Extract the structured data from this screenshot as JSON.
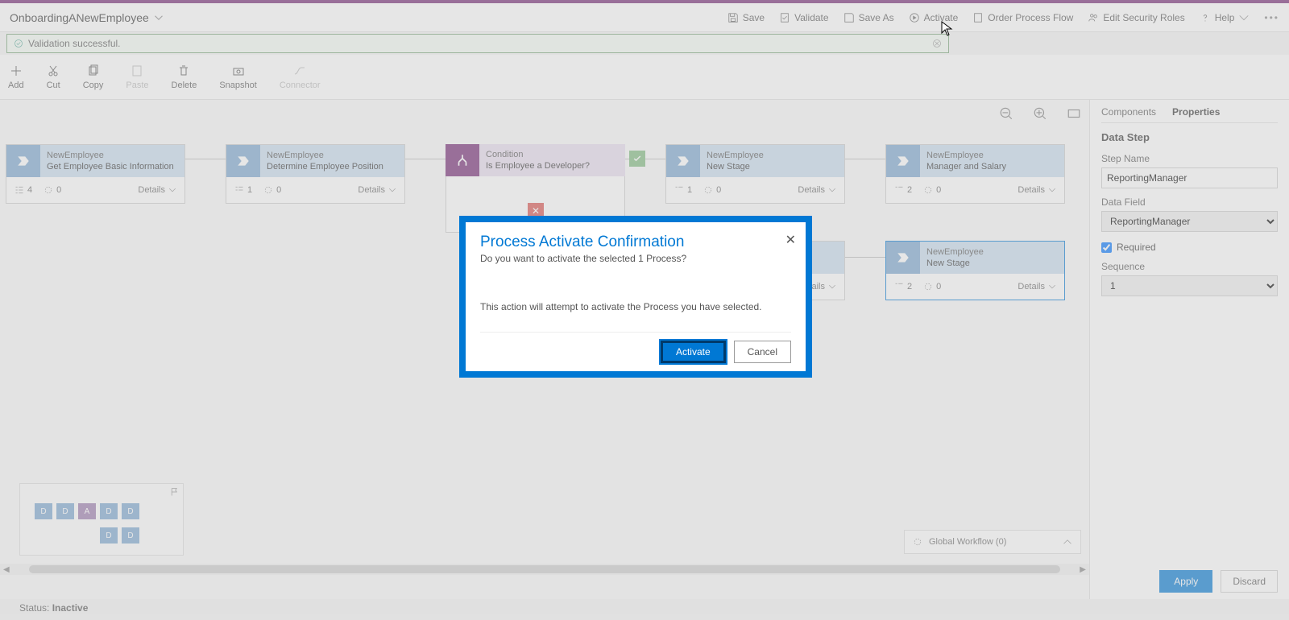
{
  "header": {
    "processTitle": "OnboardingANewEmployee",
    "actions": {
      "save": "Save",
      "validate": "Validate",
      "saveAs": "Save As",
      "activate": "Activate",
      "orderProcessFlow": "Order Process Flow",
      "editSecurityRoles": "Edit Security Roles",
      "help": "Help"
    }
  },
  "validation": {
    "message": "Validation successful."
  },
  "toolbar": {
    "add": "Add",
    "cut": "Cut",
    "copy": "Copy",
    "paste": "Paste",
    "delete": "Delete",
    "snapshot": "Snapshot",
    "connector": "Connector"
  },
  "stages": [
    {
      "entity": "NewEmployee",
      "name": "Get Employee Basic Information",
      "steps": "4",
      "loops": "0"
    },
    {
      "entity": "NewEmployee",
      "name": "Determine Employee Position",
      "steps": "1",
      "loops": "0"
    },
    {
      "entity": "Condition",
      "name": "Is Employee a Developer?"
    },
    {
      "entity": "NewEmployee",
      "name": "New Stage",
      "steps": "1",
      "loops": "0"
    },
    {
      "entity": "NewEmployee",
      "name": "Manager and Salary",
      "steps": "2",
      "loops": "0"
    },
    {
      "entity": "NewEmployee",
      "name": "New Stage",
      "steps": "2",
      "loops": "0"
    }
  ],
  "detailsLabel": "Details",
  "globalWorkflow": "Global Workflow (0)",
  "status": {
    "label": "Status:",
    "value": "Inactive"
  },
  "propertiesPanel": {
    "tabs": {
      "components": "Components",
      "properties": "Properties"
    },
    "heading": "Data Step",
    "stepNameLabel": "Step Name",
    "stepNameValue": "ReportingManager",
    "dataFieldLabel": "Data Field",
    "dataFieldValue": "ReportingManager",
    "requiredLabel": "Required",
    "sequenceLabel": "Sequence",
    "sequenceValue": "1",
    "apply": "Apply",
    "discard": "Discard"
  },
  "modal": {
    "title": "Process Activate Confirmation",
    "subtitle": "Do you want to activate the selected 1 Process?",
    "body": "This action will attempt to activate the Process you have selected.",
    "activate": "Activate",
    "cancel": "Cancel"
  }
}
